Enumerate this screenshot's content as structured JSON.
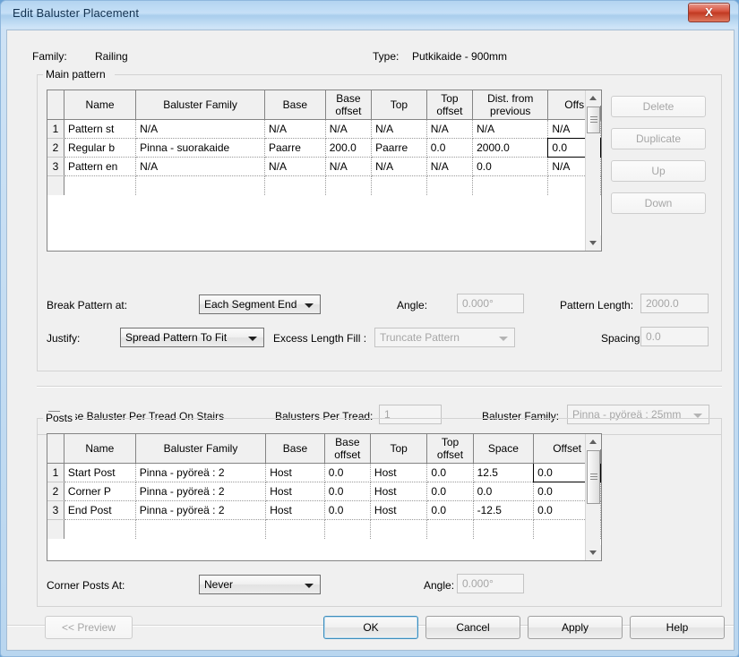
{
  "window": {
    "title": "Edit Baluster Placement",
    "close_label": "X"
  },
  "header": {
    "family_label": "Family:",
    "family_value": "Railing",
    "type_label": "Type:",
    "type_value": "Putkikaide - 900mm"
  },
  "main_pattern": {
    "group_title": "Main pattern",
    "columns": [
      "",
      "Name",
      "Baluster Family",
      "Base",
      "Base offset",
      "Top",
      "Top offset",
      "Dist. from previous",
      "Offs"
    ],
    "rows": [
      {
        "num": "1",
        "name": "Pattern st",
        "baluster_family": "N/A",
        "base": "N/A",
        "base_offset": "N/A",
        "top": "N/A",
        "top_offset": "N/A",
        "dist_from_previous": "N/A",
        "offset": "N/A"
      },
      {
        "num": "2",
        "name": "Regular b",
        "baluster_family": "Pinna - suorakaide",
        "base": "Paarre",
        "base_offset": "200.0",
        "top": "Paarre",
        "top_offset": "0.0",
        "dist_from_previous": "2000.0",
        "offset": "0.0"
      },
      {
        "num": "3",
        "name": "Pattern en",
        "baluster_family": "N/A",
        "base": "N/A",
        "base_offset": "N/A",
        "top": "N/A",
        "top_offset": "N/A",
        "dist_from_previous": "0.0",
        "offset": "N/A"
      }
    ],
    "buttons": {
      "delete": "Delete",
      "duplicate": "Duplicate",
      "up": "Up",
      "down": "Down"
    },
    "break_pattern_label": "Break Pattern at:",
    "break_pattern_value": "Each Segment End",
    "angle_label": "Angle:",
    "angle_value": "0.000°",
    "pattern_length_label": "Pattern Length:",
    "pattern_length_value": "2000.0",
    "justify_label": "Justify:",
    "justify_value": "Spread Pattern To Fit",
    "excess_length_label": "Excess Length Fill :",
    "excess_length_value": "Truncate Pattern",
    "spacing_label": "Spacing:",
    "spacing_value": "0.0"
  },
  "tread": {
    "use_baluster_per_tread_label": "Use Baluster Per Tread On Stairs",
    "use_baluster_per_tread_checked": false,
    "balusters_per_tread_label": "Balusters Per Tread:",
    "balusters_per_tread_value": "1",
    "baluster_family_label": "Baluster Family:",
    "baluster_family_value": "Pinna - pyöreä : 25mm"
  },
  "posts": {
    "group_title": "Posts",
    "columns": [
      "",
      "Name",
      "Baluster Family",
      "Base",
      "Base offset",
      "Top",
      "Top offset",
      "Space",
      "Offset"
    ],
    "rows": [
      {
        "num": "1",
        "name": "Start Post",
        "baluster_family": "Pinna - pyöreä : 2",
        "base": "Host",
        "base_offset": "0.0",
        "top": "Host",
        "top_offset": "0.0",
        "space": "12.5",
        "offset": "0.0"
      },
      {
        "num": "2",
        "name": "Corner P",
        "baluster_family": "Pinna - pyöreä : 2",
        "base": "Host",
        "base_offset": "0.0",
        "top": "Host",
        "top_offset": "0.0",
        "space": "0.0",
        "offset": "0.0"
      },
      {
        "num": "3",
        "name": "End Post",
        "baluster_family": "Pinna - pyöreä : 2",
        "base": "Host",
        "base_offset": "0.0",
        "top": "Host",
        "top_offset": "0.0",
        "space": "-12.5",
        "offset": "0.0"
      }
    ],
    "corner_posts_label": "Corner Posts At:",
    "corner_posts_value": "Never",
    "angle_label": "Angle:",
    "angle_value": "0.000°"
  },
  "footer": {
    "preview": "<< Preview",
    "ok": "OK",
    "cancel": "Cancel",
    "apply": "Apply",
    "help": "Help"
  },
  "colors": {
    "titlebar": "#b9d6ef",
    "close": "#c23a22",
    "focus": "#3c8dbd",
    "disabled_text": "#a6a6a6"
  }
}
